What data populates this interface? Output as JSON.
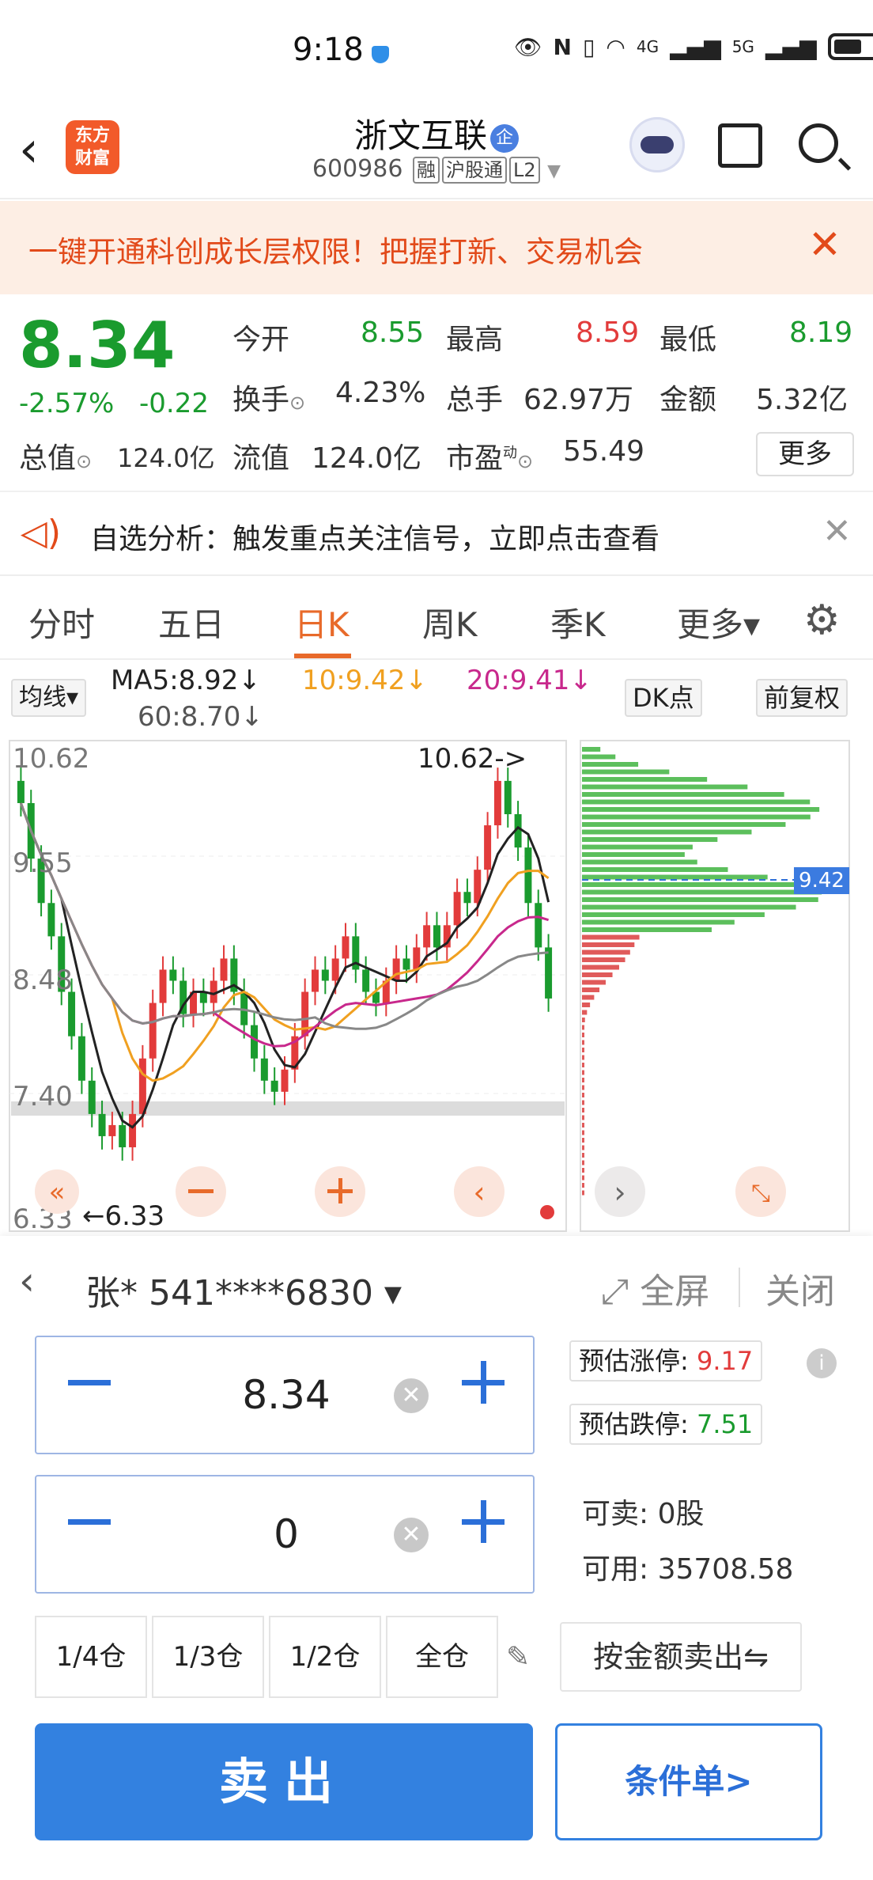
{
  "status": {
    "time": "9:18",
    "net1": "4G",
    "net2": "5G"
  },
  "header": {
    "logo": "东方\n财富",
    "name": "浙文互联",
    "badge": "企",
    "code": "600986",
    "tags": [
      "融",
      "沪股通",
      "L2"
    ]
  },
  "banner": {
    "text": "一键开通科创成长层权限！把握打新、交易机会",
    "close": "✕"
  },
  "quote": {
    "price": "8.34",
    "pct": "-2.57%",
    "chg": "-0.22",
    "open_label": "今开",
    "open": "8.55",
    "high_label": "最高",
    "high": "8.59",
    "low_label": "最低",
    "low": "8.19",
    "turn_label": "换手",
    "turn": "4.23%",
    "vol_label": "总手",
    "vol": "62.97万",
    "amt_label": "金额",
    "amt": "5.32亿",
    "mcap_label": "总值",
    "mcap": "124.0亿",
    "float_label": "流值",
    "float": "124.0亿",
    "pe_label": "市盈",
    "pe_sup": "动",
    "pe": "55.49",
    "more": "更多"
  },
  "alert": {
    "text": "自选分析：触发重点关注信号，立即点击查看"
  },
  "tabs": [
    {
      "label": "分时"
    },
    {
      "label": "五日"
    },
    {
      "label": "日K"
    },
    {
      "label": "周K"
    },
    {
      "label": "季K"
    },
    {
      "label": "更多▾"
    }
  ],
  "indicators": {
    "ma_select": "均线▾",
    "ma5": "MA5:8.92↓",
    "ma10": "10:9.42↓",
    "ma20": "20:9.41↓",
    "ma60": "60:8.70↓",
    "dk": "DK点",
    "fq": "前复权",
    "colors": {
      "ma5": "#222222",
      "ma10": "#f0a020",
      "ma20": "#c8288c",
      "ma60": "#888888"
    }
  },
  "chart_data": {
    "type": "candlestick",
    "y_high_label": "10.62",
    "y_mid1_label": "9.55",
    "y_mid2_label": "8.48",
    "y_mid3_label": "7.40",
    "y_low_label": "6.33",
    "max_marker": "10.62->",
    "min_marker": "←6.33",
    "cost_price_label": "9.42",
    "closes": [
      10.1,
      9.6,
      9.2,
      8.9,
      8.4,
      8.0,
      7.6,
      7.3,
      7.1,
      7.2,
      7.0,
      7.3,
      7.8,
      8.3,
      8.6,
      8.5,
      8.2,
      8.4,
      8.3,
      8.5,
      8.7,
      8.4,
      8.1,
      7.8,
      7.6,
      7.5,
      7.7,
      8.0,
      8.4,
      8.6,
      8.5,
      8.7,
      8.9,
      8.6,
      8.4,
      8.3,
      8.5,
      8.7,
      8.6,
      8.8,
      9.0,
      8.8,
      9.0,
      9.3,
      9.2,
      9.5,
      9.9,
      10.3,
      10.0,
      9.7,
      9.2,
      8.8,
      8.34
    ]
  },
  "trade": {
    "account": "张* 541****6830 ▾",
    "fullscreen": "全屏",
    "close": "关闭",
    "price": "8.34",
    "qty": "0",
    "up_label": "预估涨停:",
    "up": "9.17",
    "down_label": "预估跌停:",
    "down": "7.51",
    "sellable_label": "可卖:",
    "sellable": "0股",
    "available_label": "可用:",
    "available": "35708.58",
    "pos": [
      "1/4仓",
      "1/3仓",
      "1/2仓",
      "全仓"
    ],
    "amount_sell": "按金额卖出⇋",
    "sell": "卖出",
    "cond": "条件单>"
  }
}
